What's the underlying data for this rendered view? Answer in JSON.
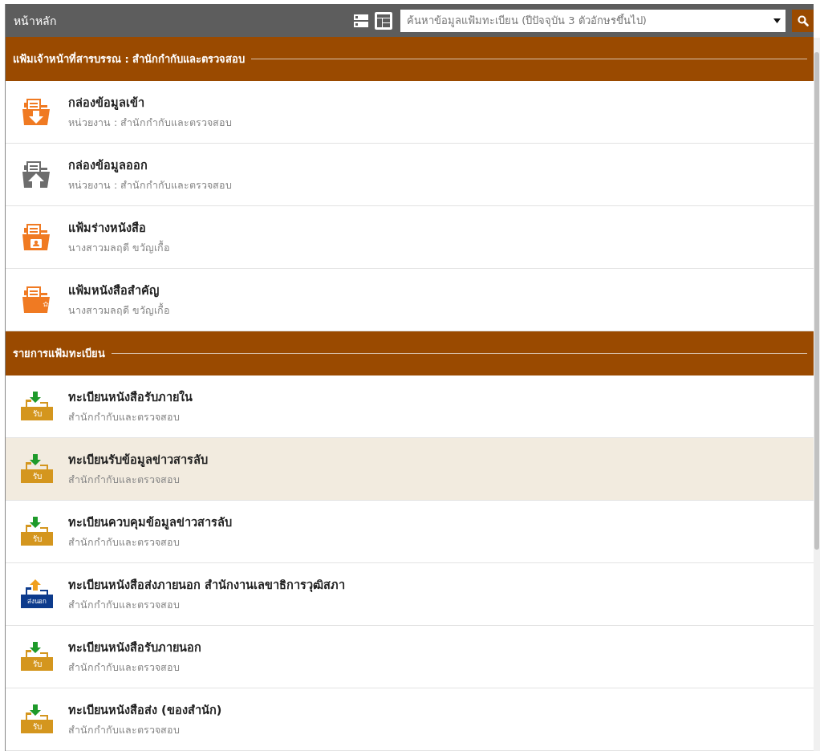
{
  "top_bar": {
    "title": "หน้าหลัก",
    "view_buttons": [
      {
        "selected": false
      },
      {
        "selected": true
      }
    ],
    "search": {
      "placeholder": "ค้นหาข้อมูลแฟ้มทะเบียน (ปีปัจจุบัน 3 ตัวอักษรขึ้นไป)"
    }
  },
  "sections": [
    {
      "title": "แฟ้มเจ้าหน้าที่สารบรรณ : สำนักกำกับและตรวจสอบ",
      "items": [
        {
          "kind": "inbox",
          "title": "กล่องข้อมูลเข้า",
          "subtitle": "หน่วยงาน : สำนักกำกับและตรวจสอบ",
          "selected": false
        },
        {
          "kind": "outbox",
          "title": "กล่องข้อมูลออก",
          "subtitle": "หน่วยงาน : สำนักกำกับและตรวจสอบ",
          "selected": false
        },
        {
          "kind": "draft",
          "title": "แฟ้มร่างหนังสือ",
          "subtitle": "นางสาวมลฤดี ขวัญเกื้อ",
          "selected": false
        },
        {
          "kind": "starred",
          "title": "แฟ้มหนังสือสำคัญ",
          "subtitle": "นางสาวมลฤดี ขวัญเกื้อ",
          "selected": false
        }
      ]
    },
    {
      "title": "รายการแฟ้มทะเบียน",
      "items": [
        {
          "kind": "receive",
          "icon_label": "รับ",
          "title": "ทะเบียนหนังสือรับภายใน",
          "subtitle": "สำนักกำกับและตรวจสอบ",
          "selected": false
        },
        {
          "kind": "receive",
          "icon_label": "รับ",
          "title": "ทะเบียนรับข้อมูลข่าวสารลับ",
          "subtitle": "สำนักกำกับและตรวจสอบ",
          "selected": true
        },
        {
          "kind": "receive",
          "icon_label": "รับ",
          "title": "ทะเบียนควบคุมข้อมูลข่าวสารลับ",
          "subtitle": "สำนักกำกับและตรวจสอบ",
          "selected": false
        },
        {
          "kind": "send",
          "icon_label": "ส่งนอก",
          "title": "ทะเบียนหนังสือส่งภายนอก สำนักงานเลขาธิการวุฒิสภา",
          "subtitle": "สำนักกำกับและตรวจสอบ",
          "selected": false
        },
        {
          "kind": "receive",
          "icon_label": "รับ",
          "title": "ทะเบียนหนังสือรับภายนอก",
          "subtitle": "สำนักกำกับและตรวจสอบ",
          "selected": false
        },
        {
          "kind": "receive",
          "icon_label": "รับ",
          "title": "ทะเบียนหนังสือส่ง (ของสำนัก)",
          "subtitle": "สำนักกำกับและตรวจสอบ",
          "selected": false
        }
      ]
    }
  ]
}
